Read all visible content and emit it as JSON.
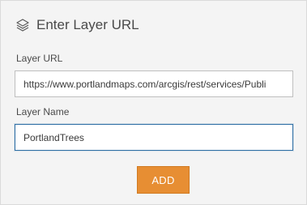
{
  "header": {
    "title": "Enter Layer URL",
    "icon": "layers-icon"
  },
  "form": {
    "url_label": "Layer URL",
    "url_value": "https://www.portlandmaps.com/arcgis/rest/services/Publi",
    "name_label": "Layer Name",
    "name_value": "PortlandTrees",
    "add_label": "ADD"
  },
  "colors": {
    "background": "#f4f4f4",
    "accent_button": "#e78e33",
    "focus_border": "#2f6fa5"
  }
}
